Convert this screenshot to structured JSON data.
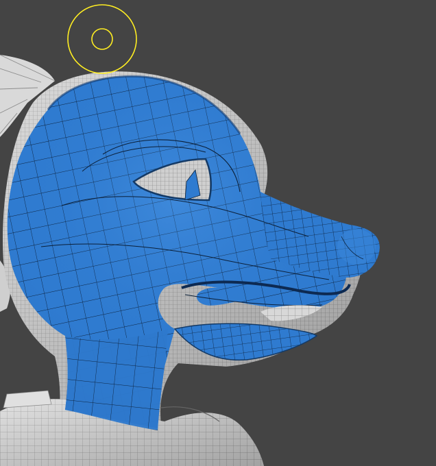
{
  "viewport": {
    "background": "#444444",
    "mesh_colors": {
      "retopo_surface": "#2f7bd0",
      "retopo_shadow": "#1f5ca8",
      "retopo_highlight": "#4b95e3",
      "retopo_wire": "#0a1c33",
      "reference_mesh": "#d6d6d6",
      "reference_wire": "#7a7a7a",
      "brush_cursor": "#ffee22"
    },
    "icons": {
      "brush": "brush-radius-cursor-icon"
    }
  }
}
